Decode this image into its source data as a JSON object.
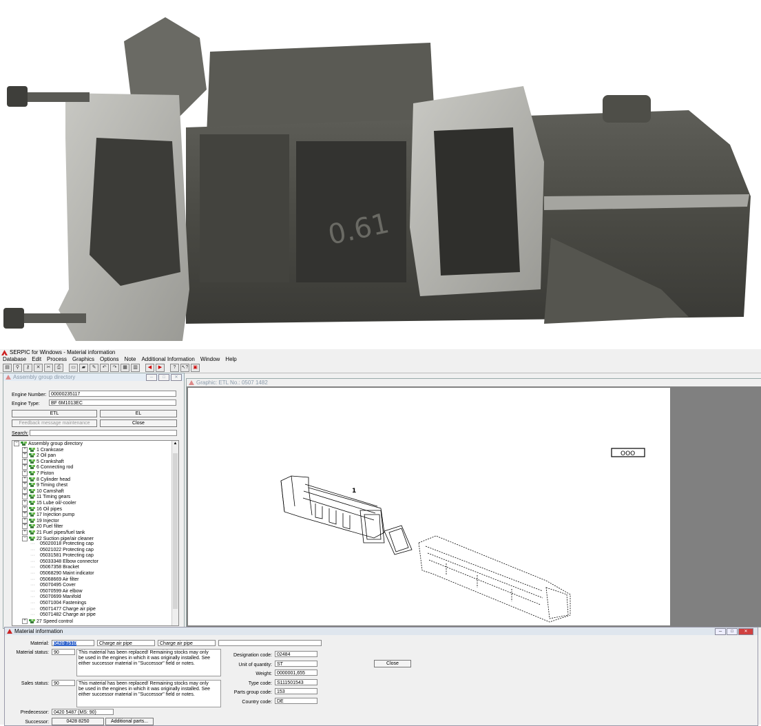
{
  "app": {
    "title": "SERPIC for Windows - Material information",
    "menu": [
      "Database",
      "Edit",
      "Process",
      "Graphics",
      "Options",
      "Note",
      "Additional Information",
      "Window",
      "Help"
    ]
  },
  "assembly": {
    "title": "Assembly group directory",
    "engine_number_label": "Engine Number:",
    "engine_number": "00000235117",
    "engine_type_label": "Engine Type:",
    "engine_type": "BF 6M1013EC",
    "btn_etl": "ETL",
    "btn_el": "EL",
    "btn_feedback": "Feedback message maintenance",
    "btn_close": "Close",
    "search_label": "Search:",
    "tree": [
      {
        "t": "Assembly group directory",
        "lvl": 0,
        "root": true
      },
      {
        "t": "1  Crankcase",
        "lvl": 1
      },
      {
        "t": "2  Oil pan",
        "lvl": 1
      },
      {
        "t": "5  Crankshaft",
        "lvl": 1
      },
      {
        "t": "6  Connecting rod",
        "lvl": 1
      },
      {
        "t": "7  Piston",
        "lvl": 1
      },
      {
        "t": "8  Cylinder head",
        "lvl": 1
      },
      {
        "t": "9  Timing chest",
        "lvl": 1
      },
      {
        "t": "10  Camshaft",
        "lvl": 1
      },
      {
        "t": "11  Timing gears",
        "lvl": 1
      },
      {
        "t": "15  Lube oil/-cooler",
        "lvl": 1
      },
      {
        "t": "16  Oil pipes",
        "lvl": 1
      },
      {
        "t": "17  Injection pump",
        "lvl": 1
      },
      {
        "t": "19  Injector",
        "lvl": 1
      },
      {
        "t": "20  Fuel filter",
        "lvl": 1
      },
      {
        "t": "21  Fuel pipes/fuel tank",
        "lvl": 1
      },
      {
        "t": "22  Suction pipe/air cleaner",
        "lvl": 1,
        "open": true
      },
      {
        "t": "05020018  Protecting cap",
        "lvl": 2
      },
      {
        "t": "05021022  Protecting cap",
        "lvl": 2
      },
      {
        "t": "05031581  Protecting cap",
        "lvl": 2
      },
      {
        "t": "05033348  Elbow connector",
        "lvl": 2
      },
      {
        "t": "05067358  Bracket",
        "lvl": 2
      },
      {
        "t": "05068290  Maint indicator",
        "lvl": 2
      },
      {
        "t": "05068669  Air filter",
        "lvl": 2
      },
      {
        "t": "05070495  Cover",
        "lvl": 2
      },
      {
        "t": "05070599  Air elbow",
        "lvl": 2
      },
      {
        "t": "05070699  Manifold",
        "lvl": 2
      },
      {
        "t": "05071004  Fastenings",
        "lvl": 2
      },
      {
        "t": "05071477  Charge air pipe",
        "lvl": 2
      },
      {
        "t": "05071482  Charge air pipe",
        "lvl": 2
      },
      {
        "t": "27  Speed control",
        "lvl": 1
      }
    ]
  },
  "graphic": {
    "title": "Graphic: ETL No.: 0507 1482",
    "label_1": "1",
    "box_label": "OOO"
  },
  "material": {
    "title": "Material information",
    "material_label": "Material:",
    "material": "0420 7510",
    "desc1": "Charge air pipe",
    "desc2": "Charge air pipe",
    "material_status_label": "Material status:",
    "material_status": "90",
    "material_status_note": "This material has been replaced! Remaining stocks may only be used in the engines in which it was originally installed. See either successor material in \"Successor\" field or notes.",
    "sales_status_label": "Sales status:",
    "sales_status": "90",
    "sales_status_note": "This material has been replaced! Remaining stocks may only be used in the engines in which it was originally installed. See either successor material in \"Successor\" field or notes.",
    "designation_code_label": "Designation code:",
    "designation_code": "02484",
    "unit_label": "Unit of quantity:",
    "unit": "ST",
    "weight_label": "Weight:",
    "weight": "0000001,655",
    "type_code_label": "Type code:",
    "type_code": "S111501543",
    "parts_group_label": "Parts group code:",
    "parts_group": "153",
    "country_label": "Country code:",
    "country": "DE",
    "close_label": "Close",
    "predecessor_label": "Predecessor:",
    "predecessor": "0420 5487 (MS: 90)",
    "successor_label": "Successor:",
    "successor": "0428 8250",
    "additional_parts_label": "Additional parts..."
  }
}
